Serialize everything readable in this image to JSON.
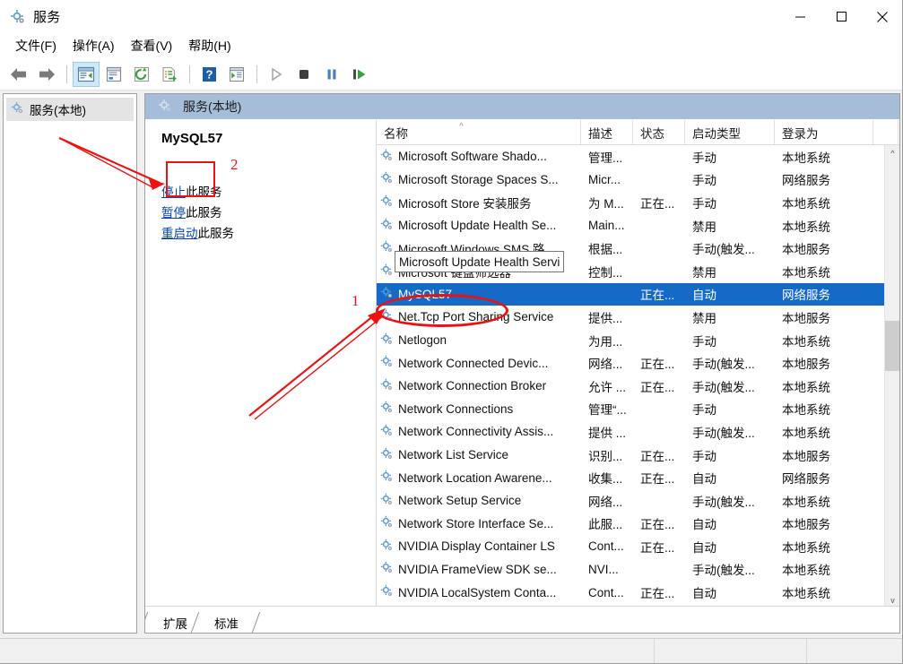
{
  "window": {
    "title": "服务",
    "icon": "services-gear-icon",
    "minimize": "–",
    "maximize": "□",
    "close": "✕"
  },
  "menu": {
    "items": [
      {
        "label": "文件(F)",
        "name": "menu-file"
      },
      {
        "label": "操作(A)",
        "name": "menu-action"
      },
      {
        "label": "查看(V)",
        "name": "menu-view"
      },
      {
        "label": "帮助(H)",
        "name": "menu-help"
      }
    ]
  },
  "toolbar": {
    "buttons": [
      {
        "name": "back-icon",
        "title": "后退"
      },
      {
        "name": "forward-icon",
        "title": "前进"
      },
      {
        "name": "show-hide-console-tree-icon",
        "title": "显示/隐藏控制台树"
      },
      {
        "name": "properties-icon",
        "title": "属性"
      },
      {
        "name": "refresh-icon",
        "title": "刷新"
      },
      {
        "name": "export-list-icon",
        "title": "导出列表"
      },
      {
        "name": "help-icon",
        "title": "帮助"
      },
      {
        "name": "show-action-pane-icon",
        "title": "显示/隐藏操作窗格"
      },
      {
        "name": "start-service-icon",
        "title": "启动服务"
      },
      {
        "name": "stop-service-icon",
        "title": "停止服务"
      },
      {
        "name": "pause-service-icon",
        "title": "暂停服务"
      },
      {
        "name": "restart-service-icon",
        "title": "重启动服务"
      }
    ]
  },
  "tree": {
    "items": [
      {
        "label": "服务(本地)",
        "name": "tree-item-services-local",
        "selected": true
      }
    ]
  },
  "pane": {
    "header": "服务(本地)"
  },
  "detail": {
    "title": "MySQL57",
    "links": [
      {
        "link": "停止",
        "rest": "此服务",
        "name": "stop-this-service-link"
      },
      {
        "link": "暂停",
        "rest": "此服务",
        "name": "pause-this-service-link"
      },
      {
        "link": "重启动",
        "rest": "此服务",
        "name": "restart-this-service-link"
      }
    ]
  },
  "list": {
    "columns": [
      {
        "label": "名称",
        "name": "column-header-name",
        "sorted": "asc"
      },
      {
        "label": "描述",
        "name": "column-header-description"
      },
      {
        "label": "状态",
        "name": "column-header-status"
      },
      {
        "label": "启动类型",
        "name": "column-header-startup-type"
      },
      {
        "label": "登录为",
        "name": "column-header-log-on-as"
      }
    ],
    "rows": [
      {
        "name": "Microsoft Software Shado...",
        "desc": "管理...",
        "status": "",
        "startup": "手动",
        "logon": "本地系统",
        "selected": false
      },
      {
        "name": "Microsoft Storage Spaces S...",
        "desc": "Micr...",
        "status": "",
        "startup": "手动",
        "logon": "网络服务",
        "selected": false
      },
      {
        "name": "Microsoft Store 安装服务",
        "desc": "为 M...",
        "status": "正在...",
        "startup": "手动",
        "logon": "本地系统",
        "selected": false
      },
      {
        "name": "Microsoft Update Health Se...",
        "desc": "Main...",
        "status": "",
        "startup": "禁用",
        "logon": "本地系统",
        "selected": false
      },
      {
        "name": "Microsoft Windows SMS 路...",
        "desc": "根据...",
        "status": "",
        "startup": "手动(触发...",
        "logon": "本地服务",
        "selected": false
      },
      {
        "name": "Microsoft 键盘筛选器",
        "desc": "控制...",
        "status": "",
        "startup": "禁用",
        "logon": "本地系统",
        "selected": false
      },
      {
        "name": "MySQL57",
        "desc": "",
        "status": "正在...",
        "startup": "自动",
        "logon": "网络服务",
        "selected": true
      },
      {
        "name": "Net.Tcp Port Sharing Service",
        "desc": "提供...",
        "status": "",
        "startup": "禁用",
        "logon": "本地服务",
        "selected": false
      },
      {
        "name": "Netlogon",
        "desc": "为用...",
        "status": "",
        "startup": "手动",
        "logon": "本地系统",
        "selected": false
      },
      {
        "name": "Network Connected Devic...",
        "desc": "网络...",
        "status": "正在...",
        "startup": "手动(触发...",
        "logon": "本地服务",
        "selected": false
      },
      {
        "name": "Network Connection Broker",
        "desc": "允许 ...",
        "status": "正在...",
        "startup": "手动(触发...",
        "logon": "本地系统",
        "selected": false
      },
      {
        "name": "Network Connections",
        "desc": "管理“...",
        "status": "",
        "startup": "手动",
        "logon": "本地系统",
        "selected": false
      },
      {
        "name": "Network Connectivity Assis...",
        "desc": "提供 ...",
        "status": "",
        "startup": "手动(触发...",
        "logon": "本地系统",
        "selected": false
      },
      {
        "name": "Network List Service",
        "desc": "识别...",
        "status": "正在...",
        "startup": "手动",
        "logon": "本地服务",
        "selected": false
      },
      {
        "name": "Network Location Awarene...",
        "desc": "收集...",
        "status": "正在...",
        "startup": "自动",
        "logon": "网络服务",
        "selected": false
      },
      {
        "name": "Network Setup Service",
        "desc": "网络...",
        "status": "",
        "startup": "手动(触发...",
        "logon": "本地系统",
        "selected": false
      },
      {
        "name": "Network Store Interface Se...",
        "desc": "此服...",
        "status": "正在...",
        "startup": "自动",
        "logon": "本地服务",
        "selected": false
      },
      {
        "name": "NVIDIA Display Container LS",
        "desc": "Cont...",
        "status": "正在...",
        "startup": "自动",
        "logon": "本地系统",
        "selected": false
      },
      {
        "name": "NVIDIA FrameView SDK se...",
        "desc": "NVI...",
        "status": "",
        "startup": "手动(触发...",
        "logon": "本地系统",
        "selected": false
      },
      {
        "name": "NVIDIA LocalSystem Conta...",
        "desc": "Cont...",
        "status": "正在...",
        "startup": "自动",
        "logon": "本地系统",
        "selected": false
      }
    ],
    "tooltip": "Microsoft Update Health Servi"
  },
  "tabs": [
    {
      "label": "扩展",
      "name": "tab-extended",
      "active": false
    },
    {
      "label": "标准",
      "name": "tab-standard",
      "active": true
    }
  ],
  "annotations": {
    "marker_one": "1",
    "marker_two": "2",
    "color": "#ee1111"
  }
}
